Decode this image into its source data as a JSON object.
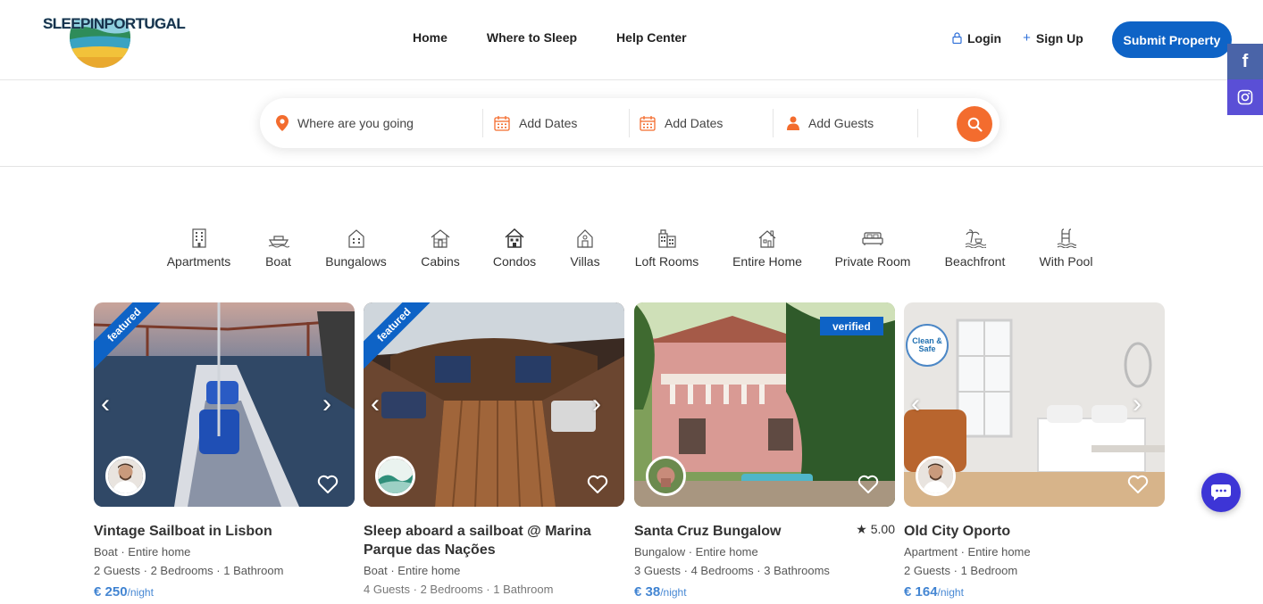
{
  "header": {
    "logo_text": "SLEEPINPORTUGAL",
    "nav": [
      "Home",
      "Where to Sleep",
      "Help Center"
    ],
    "login_label": "Login",
    "signup_label": "Sign Up",
    "submit_label": "Submit Property"
  },
  "social": {
    "facebook_glyph": "f",
    "instagram_icon": "instagram-icon"
  },
  "search": {
    "location_placeholder": "Where are you going",
    "checkin_label": "Add Dates",
    "checkout_label": "Add Dates",
    "guests_label": "Add Guests",
    "icons": [
      "map-pin-icon",
      "calendar-icon",
      "calendar-icon",
      "person-icon",
      "search-icon"
    ]
  },
  "categories": [
    {
      "label": "Apartments",
      "icon": "apartment-icon"
    },
    {
      "label": "Boat",
      "icon": "boat-icon"
    },
    {
      "label": "Bungalows",
      "icon": "bungalow-icon"
    },
    {
      "label": "Cabins",
      "icon": "cabin-icon"
    },
    {
      "label": "Condos",
      "icon": "condo-icon"
    },
    {
      "label": "Villas",
      "icon": "villa-icon"
    },
    {
      "label": "Loft Rooms",
      "icon": "loft-icon"
    },
    {
      "label": "Entire Home",
      "icon": "home-icon"
    },
    {
      "label": "Private Room",
      "icon": "bed-icon"
    },
    {
      "label": "Beachfront",
      "icon": "beach-icon"
    },
    {
      "label": "With Pool",
      "icon": "pool-icon"
    }
  ],
  "listings": [
    {
      "title": "Vintage Sailboat in Lisbon",
      "type": "Boat · Entire home",
      "details": "2 Guests · 2 Bedrooms · 1 Bathroom",
      "price": "€ 250",
      "per": "/night",
      "tag": "featured"
    },
    {
      "title": "Sleep aboard a sailboat @ Marina Parque das Nações",
      "type": "Boat · Entire home",
      "details": "4 Guests · 2 Bedrooms · 1 Bathroom",
      "price": "",
      "per": "",
      "tag": "featured"
    },
    {
      "title": "Santa Cruz Bungalow",
      "type": "Bungalow · Entire home",
      "details": "3 Guests · 4 Bedrooms · 3 Bathrooms",
      "price": "€ 38",
      "per": "/night",
      "tag": "verified",
      "rating": "5.00"
    },
    {
      "title": "Old City Oporto",
      "type": "Apartment · Entire home",
      "details": "2 Guests · 1 Bedroom",
      "price": "€ 164",
      "per": "/night",
      "tag": "Clean & Safe"
    }
  ],
  "colors": {
    "primary": "#0e63c6",
    "accent": "#f36c2e",
    "facebook": "#4a64a8",
    "instagram": "#5a4fd6",
    "chat": "#3d35d6"
  }
}
